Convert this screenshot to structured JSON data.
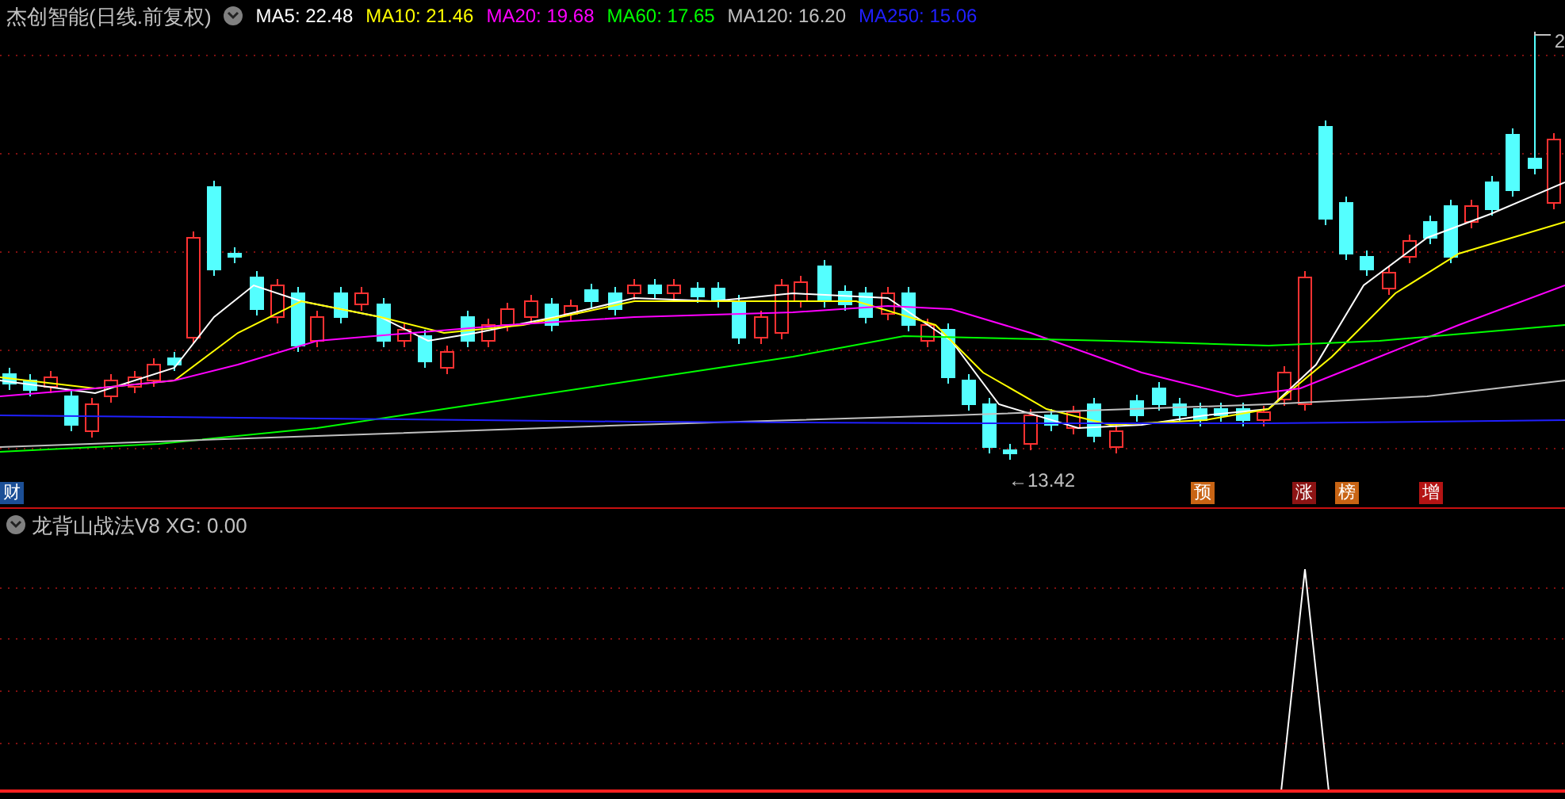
{
  "header": {
    "title": "杰创智能(日线.前复权)",
    "ma_legend": [
      {
        "label": "MA5: 22.48",
        "color": "#ffffff"
      },
      {
        "label": "MA10: 21.46",
        "color": "#ffff00"
      },
      {
        "label": "MA20: 19.68",
        "color": "#ff00ff"
      },
      {
        "label": "MA60: 17.65",
        "color": "#00ff00"
      },
      {
        "label": "MA120: 16.20",
        "color": "#c0c0c0"
      },
      {
        "label": "MA250: 15.06",
        "color": "#2020ff"
      }
    ]
  },
  "price_chart": {
    "low_label": "←13.42",
    "high_label": "2",
    "markers": [
      {
        "text": "财",
        "color": "#1c4f96"
      },
      {
        "text": "预",
        "color": "#c86414"
      },
      {
        "text": "涨",
        "color": "#8c1414"
      },
      {
        "text": "榜",
        "color": "#c86414"
      },
      {
        "text": "增",
        "color": "#b41414"
      }
    ]
  },
  "indicator": {
    "title": "龙背山战法V8 XG: 0.00"
  }
}
